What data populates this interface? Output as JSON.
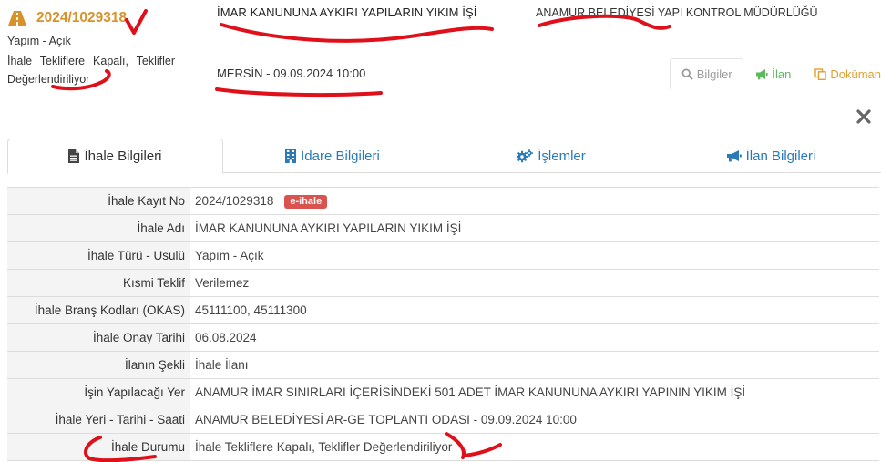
{
  "header": {
    "registry_no": "2024/1029318",
    "type_method": "Yapım - Açık",
    "status": "İhale Tekliflere Kapalı, Teklifler Değerlendiriliyor",
    "title": "İMAR KANUNUNA AYKIRI YAPILARIN YIKIM İŞİ",
    "administration": "ANAMUR BELEDİYESİ YAPI KONTROL MÜDÜRLÜĞÜ",
    "location_date": "MERSİN - 09.09.2024 10:00"
  },
  "actions": {
    "info": "Bilgiler",
    "announcement": "İlan",
    "document": "Doküman"
  },
  "tabs": [
    {
      "label": "İhale Bilgileri",
      "icon": "file-text-icon",
      "active": true
    },
    {
      "label": "İdare Bilgileri",
      "icon": "building-icon",
      "active": false
    },
    {
      "label": "İşlemler",
      "icon": "gears-icon",
      "active": false
    },
    {
      "label": "İlan Bilgileri",
      "icon": "bullhorn-icon",
      "active": false
    }
  ],
  "details": {
    "badge": "e-ihale",
    "rows": [
      {
        "label": "İhale Kayıt No",
        "value": "2024/1029318"
      },
      {
        "label": "İhale Adı",
        "value": "İMAR KANUNUNA AYKIRI YAPILARIN YIKIM İŞİ"
      },
      {
        "label": "İhale Türü - Usulü",
        "value": "Yapım - Açık"
      },
      {
        "label": "Kısmi Teklif",
        "value": "Verilemez"
      },
      {
        "label": "İhale Branş Kodları (OKAS)",
        "value": "45111100, 45111300"
      },
      {
        "label": "İhale Onay Tarihi",
        "value": "06.08.2024"
      },
      {
        "label": "İlanın Şekli",
        "value": "İhale İlanı"
      },
      {
        "label": "İşin Yapılacağı Yer",
        "value": "ANAMUR İMAR SINIRLARI İÇERİSİNDEKİ 501 ADET İMAR KANUNUNA AYKIRI YAPININ YIKIM İŞİ"
      },
      {
        "label": "İhale Yeri - Tarihi - Saati",
        "value": "ANAMUR BELEDİYESİ AR-GE TOPLANTI ODASI - 09.09.2024 10:00"
      },
      {
        "label": "İhale Durumu",
        "value": "İhale Tekliflere Kapalı, Teklifler Değerlendiriliyor"
      }
    ]
  },
  "colors": {
    "accent_orange": "#d9922b",
    "link_blue": "#2a7ab8",
    "success_green": "#5cb85c",
    "badge_red": "#d9534f",
    "annotation_red": "#e0101a"
  }
}
